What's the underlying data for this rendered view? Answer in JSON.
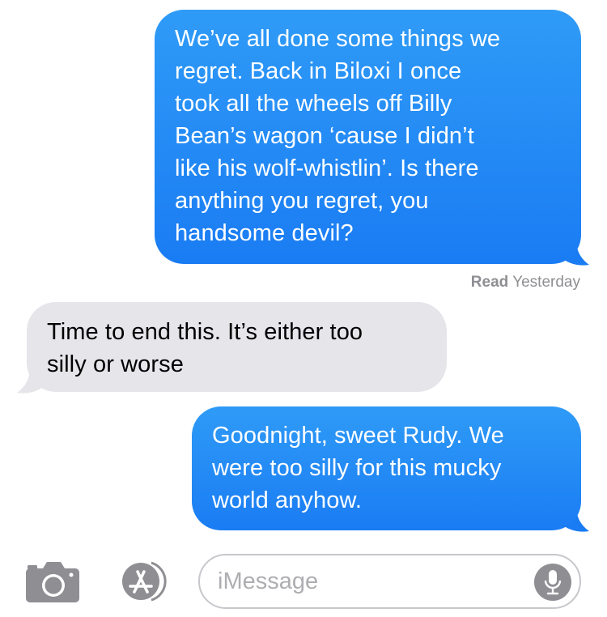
{
  "conversation": {
    "messages": [
      {
        "direction": "sent",
        "lines": [
          "We’ve all done some things we",
          "regret. Back in Biloxi I once",
          "took all the wheels off Billy",
          "Bean’s wagon ‘cause I didn’t",
          "like his wolf-whistlin’. Is there",
          "anything you regret, you",
          "handsome devil?"
        ]
      },
      {
        "direction": "received",
        "lines": [
          "Time to end this. It’s either too",
          "silly or worse"
        ]
      },
      {
        "direction": "sent",
        "lines": [
          "Goodnight, sweet Rudy. We",
          "were too silly for this mucky",
          "world anyhow."
        ]
      }
    ],
    "read_receipt": {
      "status": "Read",
      "time": "Yesterday"
    }
  },
  "composer": {
    "placeholder": "iMessage",
    "value": "",
    "icons": {
      "camera": "camera-icon",
      "app_store": "app-store-icon",
      "microphone": "microphone-icon"
    }
  },
  "colors": {
    "sent_bubble": "#1A7CF3",
    "received_bubble": "#E5E5EA",
    "icon_gray": "#8E8E93"
  }
}
